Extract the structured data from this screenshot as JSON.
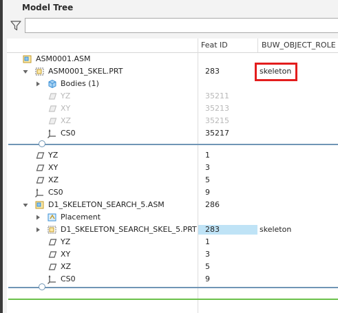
{
  "panel_title": "Model Tree",
  "filter": {
    "value": "",
    "placeholder": ""
  },
  "columns": {
    "feat_id": "Feat ID",
    "role": "BUW_OBJECT_ROLE"
  },
  "rows": [
    {
      "label": "ASM0001.ASM",
      "feat_id": "",
      "role": "",
      "icon": "assembly-icon",
      "toggle": "none",
      "dim": false
    },
    {
      "label": "ASM0001_SKEL.PRT",
      "feat_id": "283",
      "role": "skeleton",
      "icon": "skeleton-part-icon",
      "toggle": "expanded",
      "dim": false
    },
    {
      "label": "Bodies (1)",
      "feat_id": "",
      "role": "",
      "icon": "bodies-icon",
      "toggle": "collapsed",
      "dim": false
    },
    {
      "label": "YZ",
      "feat_id": "35211",
      "role": "",
      "icon": "datum-plane-icon",
      "toggle": "none",
      "dim": true
    },
    {
      "label": "XY",
      "feat_id": "35213",
      "role": "",
      "icon": "datum-plane-icon",
      "toggle": "none",
      "dim": true
    },
    {
      "label": "XZ",
      "feat_id": "35215",
      "role": "",
      "icon": "datum-plane-icon",
      "toggle": "none",
      "dim": true
    },
    {
      "label": "CS0",
      "feat_id": "35217",
      "role": "",
      "icon": "coordinate-system-icon",
      "toggle": "none",
      "dim": false
    },
    {
      "label": "YZ",
      "feat_id": "1",
      "role": "",
      "icon": "datum-plane-icon",
      "toggle": "none",
      "dim": false
    },
    {
      "label": "XY",
      "feat_id": "3",
      "role": "",
      "icon": "datum-plane-icon",
      "toggle": "none",
      "dim": false
    },
    {
      "label": "XZ",
      "feat_id": "5",
      "role": "",
      "icon": "datum-plane-icon",
      "toggle": "none",
      "dim": false
    },
    {
      "label": "CS0",
      "feat_id": "9",
      "role": "",
      "icon": "coordinate-system-icon",
      "toggle": "none",
      "dim": false
    },
    {
      "label": "D1_SKELETON_SEARCH_5.ASM",
      "feat_id": "286",
      "role": "",
      "icon": "assembly-icon",
      "toggle": "expanded",
      "dim": false
    },
    {
      "label": "Placement",
      "feat_id": "",
      "role": "",
      "icon": "placement-icon",
      "toggle": "collapsed",
      "dim": false
    },
    {
      "label": "D1_SKELETON_SEARCH_SKEL_5.PRT",
      "feat_id": "283",
      "role": "skeleton",
      "icon": "skeleton-part-icon",
      "toggle": "collapsed",
      "dim": false
    },
    {
      "label": "YZ",
      "feat_id": "1",
      "role": "",
      "icon": "datum-plane-icon",
      "toggle": "none",
      "dim": false
    },
    {
      "label": "XY",
      "feat_id": "3",
      "role": "",
      "icon": "datum-plane-icon",
      "toggle": "none",
      "dim": false
    },
    {
      "label": "XZ",
      "feat_id": "5",
      "role": "",
      "icon": "datum-plane-icon",
      "toggle": "none",
      "dim": false
    },
    {
      "label": "CS0",
      "feat_id": "9",
      "role": "",
      "icon": "coordinate-system-icon",
      "toggle": "none",
      "dim": false
    }
  ],
  "colors": {
    "highlight_feat_id": "#bfe3f6",
    "annotation_box": "#e31d1d",
    "insert_separator": "#6f95b5",
    "insert_line": "#6ac14a"
  }
}
